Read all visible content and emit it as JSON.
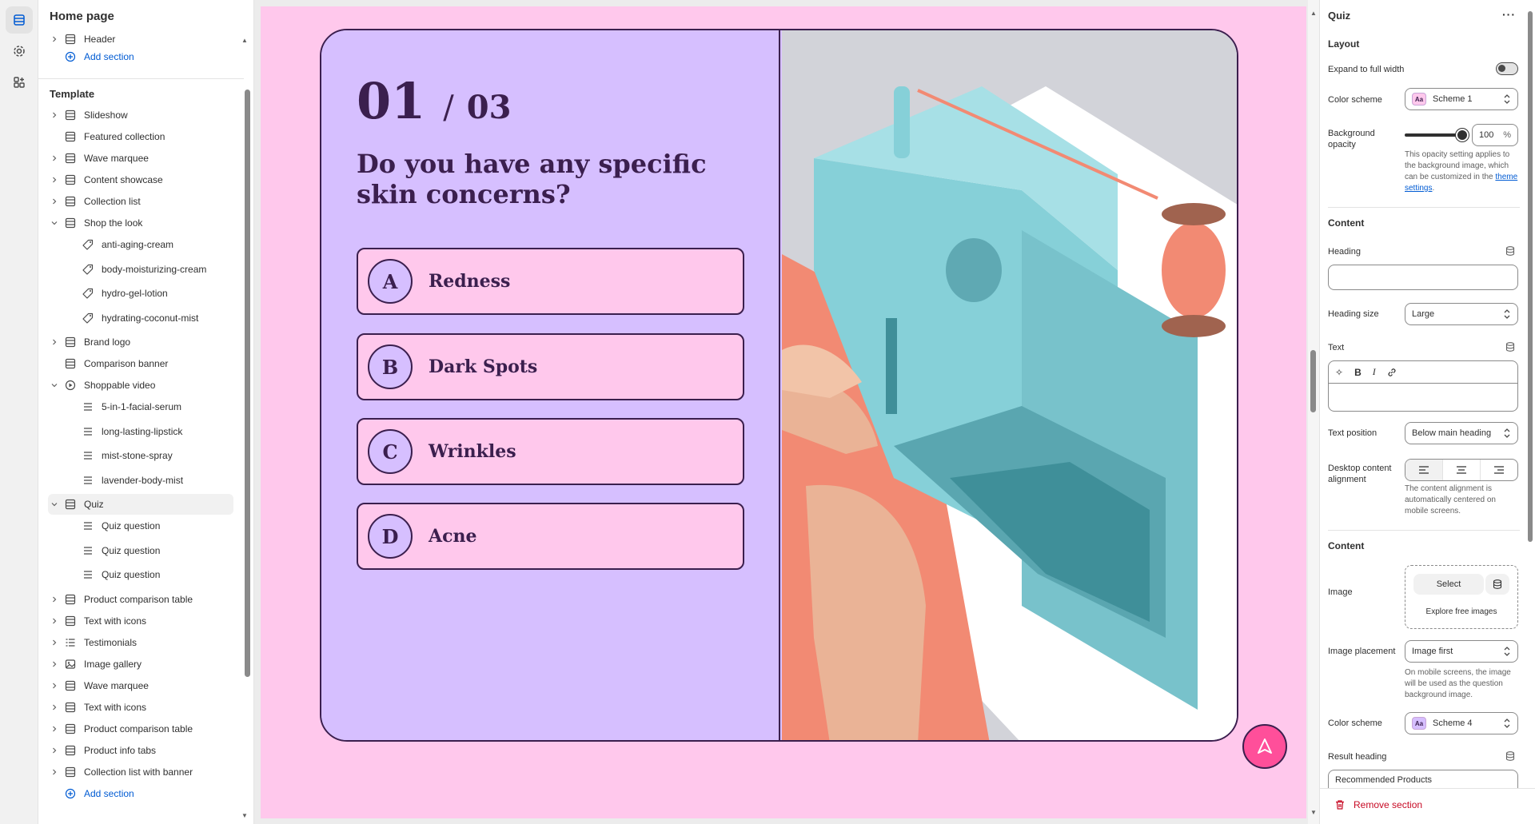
{
  "left_panel": {
    "page_title": "Home page",
    "header_group": [
      {
        "label": "Header",
        "kind": "section",
        "expandable": true
      },
      {
        "label": "Add section",
        "kind": "add"
      }
    ],
    "template_label": "Template",
    "template_items": [
      {
        "label": "Slideshow",
        "kind": "section",
        "expandable": true,
        "level": 0
      },
      {
        "label": "Featured collection",
        "kind": "section",
        "expandable": false,
        "level": 0
      },
      {
        "label": "Wave marquee",
        "kind": "section",
        "expandable": true,
        "level": 0
      },
      {
        "label": "Content showcase",
        "kind": "section",
        "expandable": true,
        "level": 0
      },
      {
        "label": "Collection list",
        "kind": "section",
        "expandable": true,
        "level": 0
      },
      {
        "label": "Shop the look",
        "kind": "section",
        "expandable": true,
        "expanded": true,
        "level": 0
      },
      {
        "label": "anti-aging-cream",
        "kind": "tag",
        "level": 1
      },
      {
        "label": "body-moisturizing-cream",
        "kind": "tag",
        "level": 1
      },
      {
        "label": "hydro-gel-lotion",
        "kind": "tag",
        "level": 1
      },
      {
        "label": "hydrating-coconut-mist",
        "kind": "tag",
        "level": 1
      },
      {
        "label": "Brand logo",
        "kind": "section",
        "expandable": true,
        "level": 0
      },
      {
        "label": "Comparison banner",
        "kind": "section",
        "expandable": false,
        "level": 0
      },
      {
        "label": "Shoppable video",
        "kind": "video",
        "expandable": true,
        "expanded": true,
        "level": 0
      },
      {
        "label": "5-in-1-facial-serum",
        "kind": "block",
        "level": 1
      },
      {
        "label": "long-lasting-lipstick",
        "kind": "block",
        "level": 1
      },
      {
        "label": "mist-stone-spray",
        "kind": "block",
        "level": 1
      },
      {
        "label": "lavender-body-mist",
        "kind": "block",
        "level": 1
      },
      {
        "label": "Quiz",
        "kind": "section",
        "expandable": true,
        "expanded": true,
        "level": 0,
        "selected": true
      },
      {
        "label": "Quiz question",
        "kind": "block",
        "level": 1
      },
      {
        "label": "Quiz question",
        "kind": "block",
        "level": 1
      },
      {
        "label": "Quiz question",
        "kind": "block",
        "level": 1
      },
      {
        "label": "Product comparison table",
        "kind": "section",
        "expandable": true,
        "level": 0
      },
      {
        "label": "Text with icons",
        "kind": "section",
        "expandable": true,
        "level": 0
      },
      {
        "label": "Testimonials",
        "kind": "list",
        "expandable": true,
        "level": 0
      },
      {
        "label": "Image gallery",
        "kind": "image",
        "expandable": true,
        "level": 0
      },
      {
        "label": "Wave marquee",
        "kind": "section",
        "expandable": true,
        "level": 0
      },
      {
        "label": "Text with icons",
        "kind": "section",
        "expandable": true,
        "level": 0
      },
      {
        "label": "Product comparison table",
        "kind": "section",
        "expandable": true,
        "level": 0
      },
      {
        "label": "Product info tabs",
        "kind": "section",
        "expandable": true,
        "level": 0
      },
      {
        "label": "Collection list with banner",
        "kind": "section",
        "expandable": true,
        "level": 0
      },
      {
        "label": "Add section",
        "kind": "add",
        "level": 0
      }
    ]
  },
  "preview": {
    "counter_current": "01",
    "counter_sep": "/",
    "counter_total": "03",
    "question": "Do you have any specific skin concerns?",
    "answers": [
      {
        "letter": "A",
        "text": "Redness"
      },
      {
        "letter": "B",
        "text": "Dark Spots"
      },
      {
        "letter": "C",
        "text": "Wrinkles"
      },
      {
        "letter": "D",
        "text": "Acne"
      }
    ],
    "colors": {
      "background": "#ffc8ec",
      "card": "#d6bfff",
      "ink": "#3b1f4e",
      "fab": "#ff4f9a"
    }
  },
  "settings": {
    "title": "Quiz",
    "layout_heading": "Layout",
    "expand_label": "Expand to full width",
    "color_scheme_label": "Color scheme",
    "color_scheme_value": "Scheme 1",
    "bg_opacity_label": "Background opacity",
    "bg_opacity_value": "100",
    "bg_opacity_unit": "%",
    "bg_opacity_level": 1.0,
    "opacity_help": "This opacity setting applies to the background image, which can be customized in the",
    "theme_settings_link": "theme settings",
    "content_heading": "Content",
    "heading_label": "Heading",
    "heading_value": "",
    "heading_size_label": "Heading size",
    "heading_size_value": "Large",
    "text_label": "Text",
    "text_position_label": "Text position",
    "text_position_value": "Below main heading",
    "alignment_label": "Desktop content alignment",
    "alignment_help": "The content alignment is automatically centered on mobile screens.",
    "content_heading_2": "Content",
    "image_label": "Image",
    "select_label": "Select",
    "explore_label": "Explore free images",
    "image_placement_label": "Image placement",
    "image_placement_value": "Image first",
    "placement_help": "On mobile screens, the image will be used as the question background image.",
    "color_scheme_label_2": "Color scheme",
    "color_scheme_value_2": "Scheme 4",
    "result_heading_label": "Result heading",
    "result_heading_value": "Recommended Products",
    "remove_label": "Remove section"
  }
}
